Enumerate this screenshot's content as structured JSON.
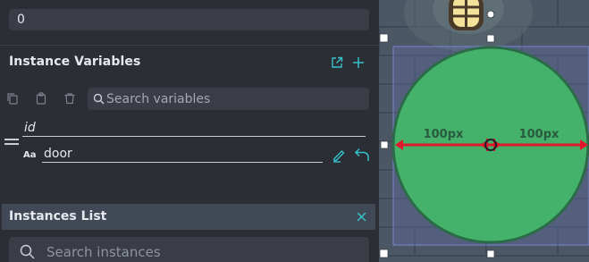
{
  "properties": {
    "number_value": "0"
  },
  "instance_variables": {
    "title": "Instance Variables",
    "header_actions": [
      "open-in-new-icon",
      "add-icon"
    ],
    "toolbar_icons": [
      "copy-icon",
      "paste-icon",
      "delete-icon"
    ],
    "search_placeholder": "Search variables",
    "variable": {
      "name": "id",
      "type_badge": "Aa",
      "value": "door"
    }
  },
  "instances_list": {
    "title": "Instances List",
    "search_placeholder": "Search instances"
  },
  "canvas": {
    "width_label_left": "100px",
    "width_label_right": "100px",
    "colors": {
      "circle_fill": "#44b26a",
      "circle_stroke": "#2c6b47",
      "dimension_line": "#e0182c",
      "selection": "#6d79c6",
      "accent_icon": "#35c1c9"
    }
  }
}
